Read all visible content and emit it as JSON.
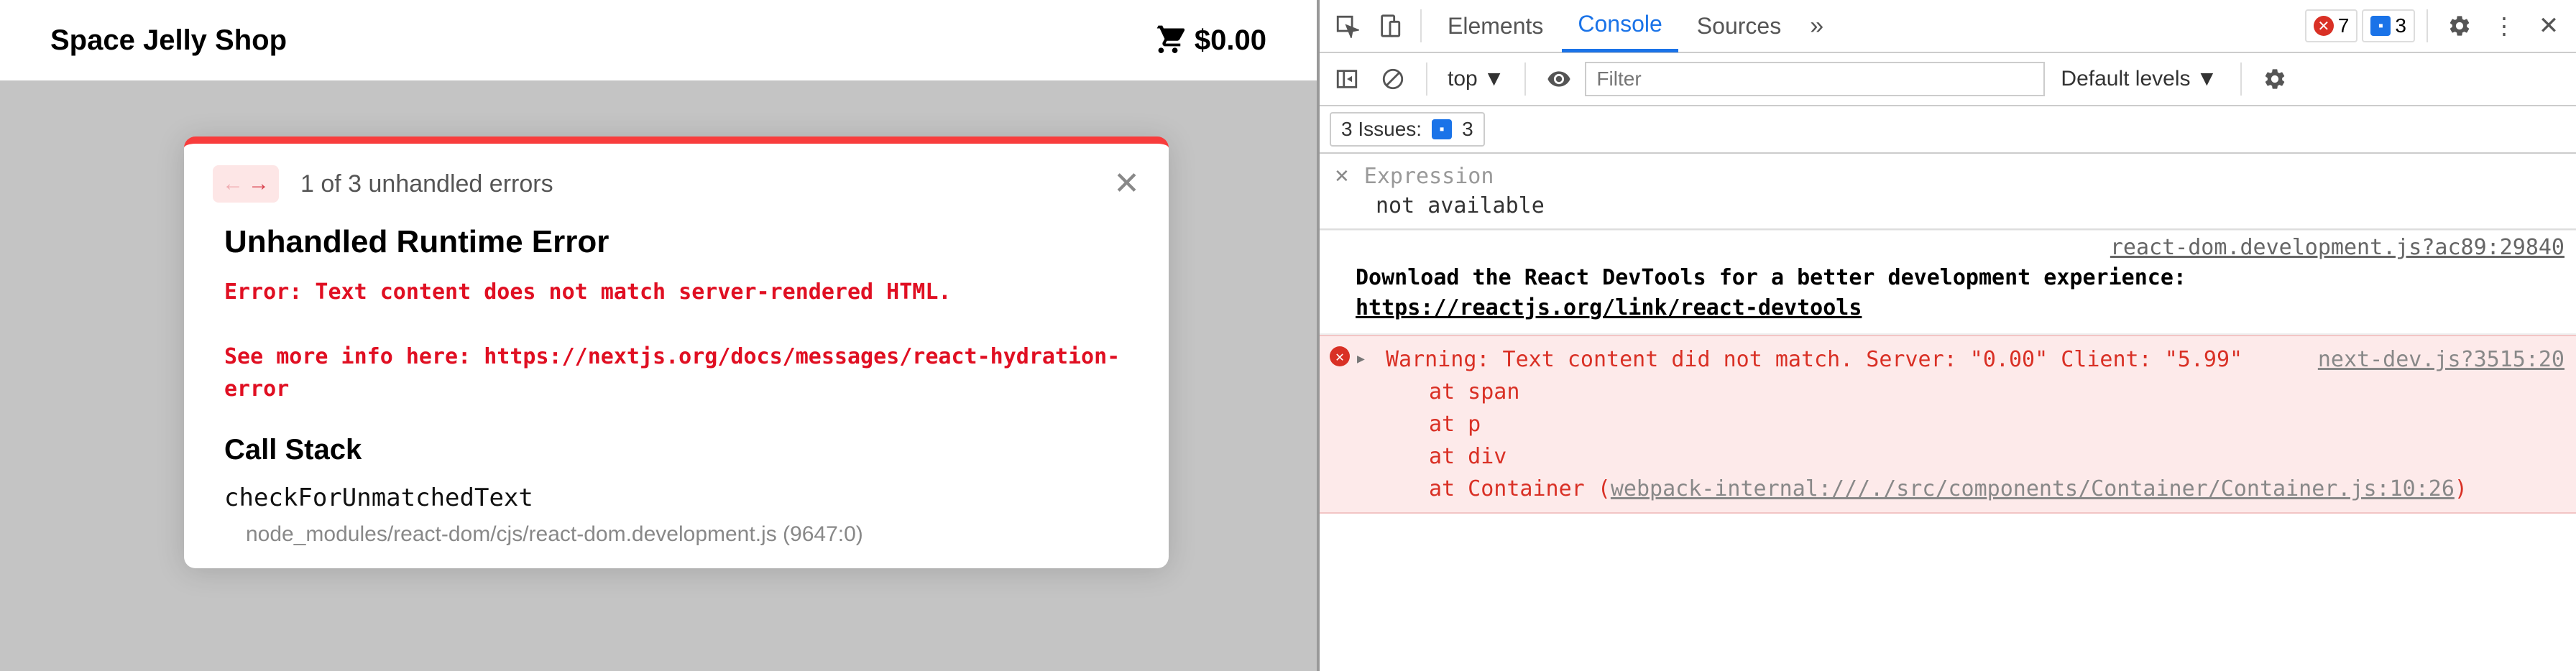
{
  "app": {
    "title": "Space Jelly Shop",
    "cart_total": "$0.00"
  },
  "error_overlay": {
    "counter": "1 of 3 unhandled errors",
    "heading": "Unhandled Runtime Error",
    "message": "Error: Text content does not match server-rendered HTML.\n\nSee more info here: https://nextjs.org/docs/messages/react-hydration-error",
    "callstack_heading": "Call Stack",
    "stack": {
      "fn": "checkForUnmatchedText",
      "src": "node_modules/react-dom/cjs/react-dom.development.js (9647:0)"
    }
  },
  "devtools": {
    "tabs": {
      "elements": "Elements",
      "console": "Console",
      "sources": "Sources"
    },
    "error_count": "7",
    "info_count": "3",
    "context": "top",
    "filter_placeholder": "Filter",
    "levels": "Default levels",
    "issues_label": "3 Issues:",
    "issues_count": "3",
    "expression_label": "Expression",
    "expression_value": "not available",
    "react_src": "react-dom.development.js?ac89:29840",
    "react_msg": "Download the React DevTools for a better development experience: ",
    "react_link": "https://reactjs.org/link/react-devtools",
    "warn_src": "next-dev.js?3515:20",
    "warn_line1": "Warning: Text content did not match. Server: \"0.00\" Client: \"5.99\"",
    "warn_at1": "at span",
    "warn_at2": "at p",
    "warn_at3": "at div",
    "warn_at4_pre": "at Container (",
    "warn_at4_link": "webpack-internal:///./src/components/Container/Container.js:10:26",
    "warn_at4_post": ")"
  }
}
